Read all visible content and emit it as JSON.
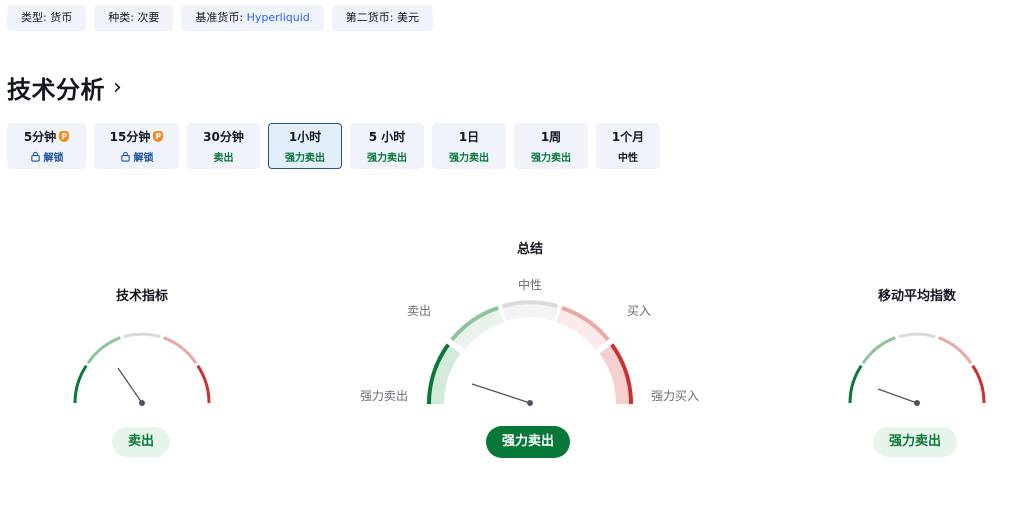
{
  "tags": [
    {
      "prefix": "类型: ",
      "value": "货币",
      "is_link": false
    },
    {
      "prefix": "种类: ",
      "value": "次要",
      "is_link": false
    },
    {
      "prefix": "基准货币: ",
      "value": "Hyperliquid",
      "is_link": true
    },
    {
      "prefix": "第二货币: ",
      "value": "美元",
      "is_link": false
    }
  ],
  "title": "技术分析",
  "title_chevron": "›",
  "periods": [
    {
      "label": "5分钟",
      "signal": "解锁",
      "locked": true
    },
    {
      "label": "15分钟",
      "signal": "解锁",
      "locked": true
    },
    {
      "label": "30分钟",
      "signal": "卖出",
      "locked": false
    },
    {
      "label": "1小时",
      "signal": "强力卖出",
      "locked": false,
      "active": true
    },
    {
      "label": "5 小时",
      "signal": "强力卖出",
      "locked": false
    },
    {
      "label": "1日",
      "signal": "强力卖出",
      "locked": false
    },
    {
      "label": "1周",
      "signal": "强力卖出",
      "locked": false
    },
    {
      "label": "1个月",
      "signal": "中性",
      "locked": false,
      "neutral": true
    }
  ],
  "gauges": {
    "oscillators": {
      "title": "技术指标",
      "result": "卖出"
    },
    "summary": {
      "title": "总结",
      "result": "强力卖出",
      "labels": {
        "strong_sell": "强力卖出",
        "sell": "卖出",
        "neutral": "中性",
        "buy": "买入",
        "strong_buy": "强力买入"
      }
    },
    "moving_averages": {
      "title": "移动平均指数",
      "result": "强力卖出"
    }
  },
  "colors": {
    "strong_sell": "#087838",
    "sell": "#8cc49b",
    "neutral": "#d9dade",
    "buy": "#eaa7a3",
    "strong_buy": "#cc2f2f",
    "accent": "#1e53a0"
  }
}
